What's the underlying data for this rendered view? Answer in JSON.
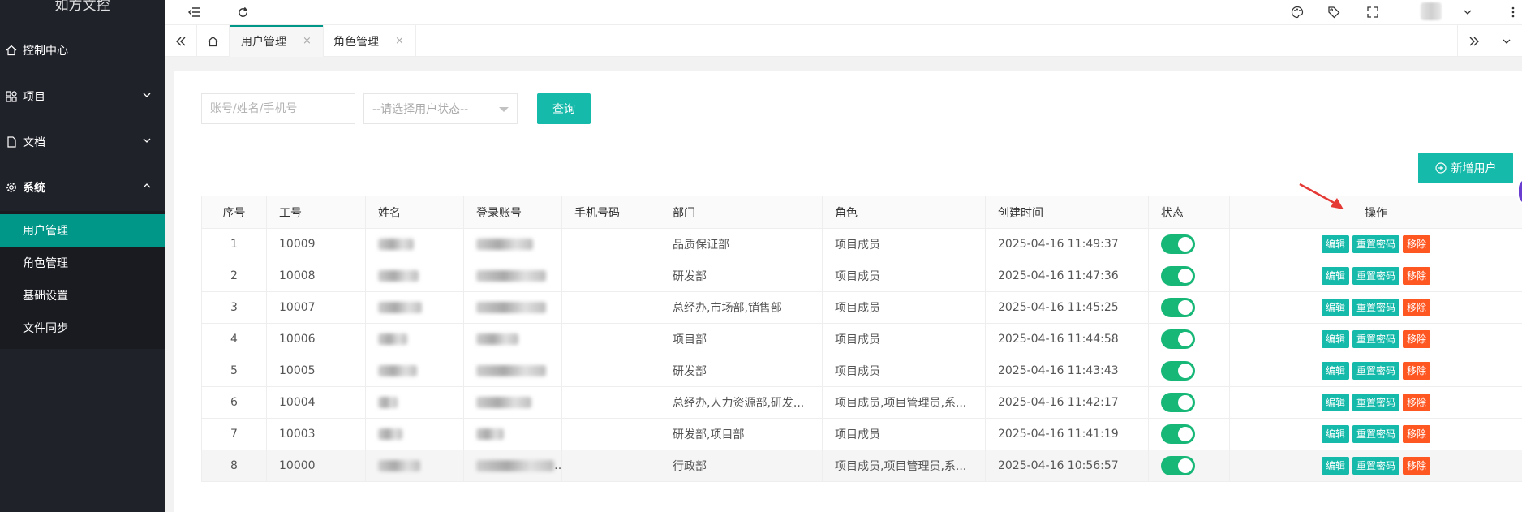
{
  "app": {
    "title": "如方文控"
  },
  "sidebar": {
    "items": [
      {
        "label": "控制中心",
        "icon": "home-icon"
      },
      {
        "label": "项目",
        "icon": "app-icon"
      },
      {
        "label": "文档",
        "icon": "file-icon"
      },
      {
        "label": "系统",
        "icon": "gear-icon"
      }
    ],
    "sub_items": [
      {
        "label": "用户管理",
        "active": true
      },
      {
        "label": "角色管理"
      },
      {
        "label": "基础设置"
      },
      {
        "label": "文件同步"
      }
    ]
  },
  "tabs": [
    {
      "label": "用户管理",
      "close": "×",
      "active": true
    },
    {
      "label": "角色管理",
      "close": "×"
    }
  ],
  "search": {
    "account_placeholder": "账号/姓名/手机号",
    "status_placeholder": "--请选择用户状态--",
    "query_label": "查询"
  },
  "toolbar": {
    "add_user_label": "新增用户"
  },
  "table": {
    "headers": [
      "序号",
      "工号",
      "姓名",
      "登录账号",
      "手机号码",
      "部门",
      "角色",
      "创建时间",
      "状态",
      "操作"
    ],
    "rows": [
      {
        "seq": "1",
        "job_no": "10009",
        "dept": "品质保证部",
        "role": "项目成员",
        "created": "2025-04-16 11:49:37"
      },
      {
        "seq": "2",
        "job_no": "10008",
        "dept": "研发部",
        "role": "项目成员",
        "created": "2025-04-16 11:47:36"
      },
      {
        "seq": "3",
        "job_no": "10007",
        "dept": "总经办,市场部,销售部",
        "role": "项目成员",
        "created": "2025-04-16 11:45:25"
      },
      {
        "seq": "4",
        "job_no": "10006",
        "dept": "项目部",
        "role": "项目成员",
        "created": "2025-04-16 11:44:58"
      },
      {
        "seq": "5",
        "job_no": "10005",
        "dept": "研发部",
        "role": "项目成员",
        "created": "2025-04-16 11:43:43"
      },
      {
        "seq": "6",
        "job_no": "10004",
        "dept": "总经办,人力资源部,研发...",
        "role": "项目成员,项目管理员,系...",
        "created": "2025-04-16 11:42:17"
      },
      {
        "seq": "7",
        "job_no": "10003",
        "dept": "研发部,项目部",
        "role": "项目成员",
        "created": "2025-04-16 11:41:19"
      },
      {
        "seq": "8",
        "job_no": "10000",
        "dept": "行政部",
        "role": "项目成员,项目管理员,系...",
        "created": "2025-04-16 10:56:57"
      }
    ],
    "actions": {
      "edit": "编辑",
      "reset": "重置密码",
      "remove": "移除"
    }
  },
  "colors": {
    "sidebar_bg": "#20222a",
    "accent": "#009688",
    "button": "#16baaa",
    "danger": "#ff5722",
    "switch_on": "#16b777"
  }
}
